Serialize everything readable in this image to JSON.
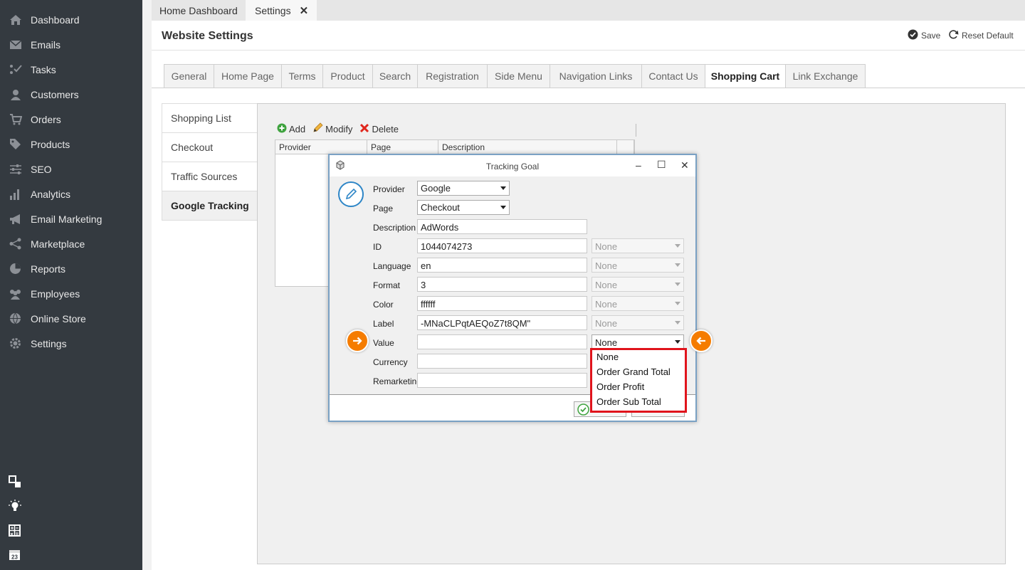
{
  "sidebar": {
    "items": [
      {
        "label": "Dashboard",
        "icon": "home-icon"
      },
      {
        "label": "Emails",
        "icon": "envelope-icon"
      },
      {
        "label": "Tasks",
        "icon": "tasks-icon"
      },
      {
        "label": "Customers",
        "icon": "user-icon"
      },
      {
        "label": "Orders",
        "icon": "cart-icon"
      },
      {
        "label": "Products",
        "icon": "tag-icon"
      },
      {
        "label": "SEO",
        "icon": "sliders-icon"
      },
      {
        "label": "Analytics",
        "icon": "bar-chart-icon"
      },
      {
        "label": "Email Marketing",
        "icon": "megaphone-icon"
      },
      {
        "label": "Marketplace",
        "icon": "share-icon"
      },
      {
        "label": "Reports",
        "icon": "pie-chart-icon"
      },
      {
        "label": "Employees",
        "icon": "users-icon"
      },
      {
        "label": "Online Store",
        "icon": "globe-icon"
      },
      {
        "label": "Settings",
        "icon": "gear-icon"
      }
    ],
    "bottom_icons": [
      "windows-icon",
      "lightbulb-icon",
      "calculator-icon",
      "calendar-icon"
    ],
    "calendar_day": "23"
  },
  "tabs": {
    "home": "Home Dashboard",
    "settings": "Settings",
    "close": "✕"
  },
  "header": {
    "title": "Website Settings",
    "save": "Save",
    "reset": "Reset Default"
  },
  "settings_tabs": [
    "General",
    "Home Page",
    "Terms",
    "Product",
    "Search",
    "Registration",
    "Side Menu",
    "Navigation Links",
    "Contact Us",
    "Shopping Cart",
    "Link Exchange"
  ],
  "active_settings_tab": "Shopping Cart",
  "subnav": [
    "Shopping List",
    "Checkout",
    "Traffic Sources",
    "Google Tracking"
  ],
  "active_subnav": "Google Tracking",
  "toolbar": {
    "add": "Add",
    "modify": "Modify",
    "delete": "Delete"
  },
  "grid": {
    "columns": [
      "Provider",
      "Page",
      "Description",
      ""
    ]
  },
  "dialog": {
    "title": "Tracking Goal",
    "minimize": "–",
    "maximize": "☐",
    "close": "✕",
    "fields": {
      "provider": {
        "label": "Provider",
        "value": "Google"
      },
      "page": {
        "label": "Page",
        "value": "Checkout"
      },
      "description": {
        "label": "Description",
        "value": "AdWords"
      },
      "id": {
        "label": "ID",
        "value": "1044074273",
        "option": "None"
      },
      "language": {
        "label": "Language",
        "value": "en",
        "option": "None"
      },
      "format": {
        "label": "Format",
        "value": "3",
        "option": "None"
      },
      "color": {
        "label": "Color",
        "value": "ffffff",
        "option": "None"
      },
      "label": {
        "label": "Label",
        "value": "-MNaCLPqtAEQoZ7t8QM\"",
        "option": "None"
      },
      "value": {
        "label": "Value",
        "value": "",
        "option": "None"
      },
      "currency": {
        "label": "Currency",
        "value": ""
      },
      "remarketing": {
        "label": "Remarketing",
        "value": ""
      }
    }
  },
  "dropdown": {
    "options": [
      "None",
      "Order Grand Total",
      "Order Profit",
      "Order Sub Total"
    ]
  },
  "colors": {
    "sidebar": "#343a40",
    "accent": "#f57c00",
    "highlight": "#e0141c"
  }
}
